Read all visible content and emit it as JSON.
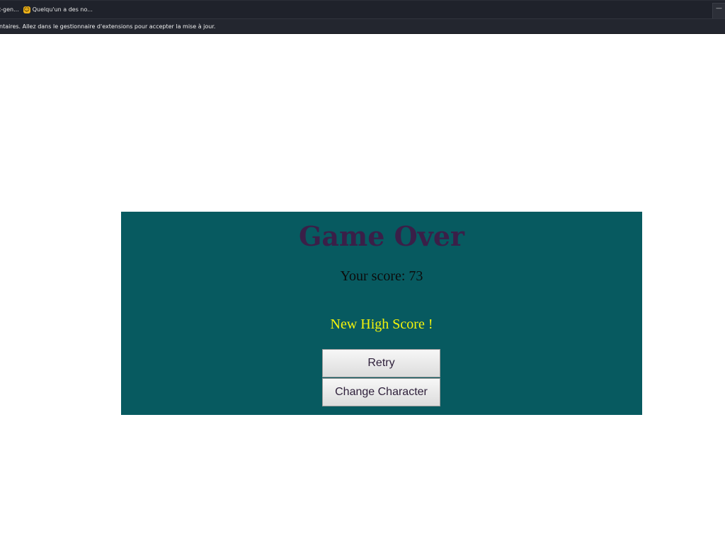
{
  "browser": {
    "bookmarks": [
      {
        "label": "t-gen..."
      },
      {
        "label": "Quelqu'un a des no...",
        "icon": "emoji-face-icon"
      }
    ],
    "notice": "ntaires. Allez dans le gestionnaire d'extensions pour accepter la mise à jour.",
    "corner_glyph": "—"
  },
  "game_over": {
    "title": "Game Over",
    "score_text": "Your score: 73",
    "high_score_text": "New High Score !",
    "buttons": {
      "retry": "Retry",
      "change_character": "Change Character"
    }
  },
  "colors": {
    "panel_bg": "#075a60",
    "title": "#3a1f48",
    "high_score": "#f4f40a",
    "toolbar_bg": "#1f222b"
  }
}
